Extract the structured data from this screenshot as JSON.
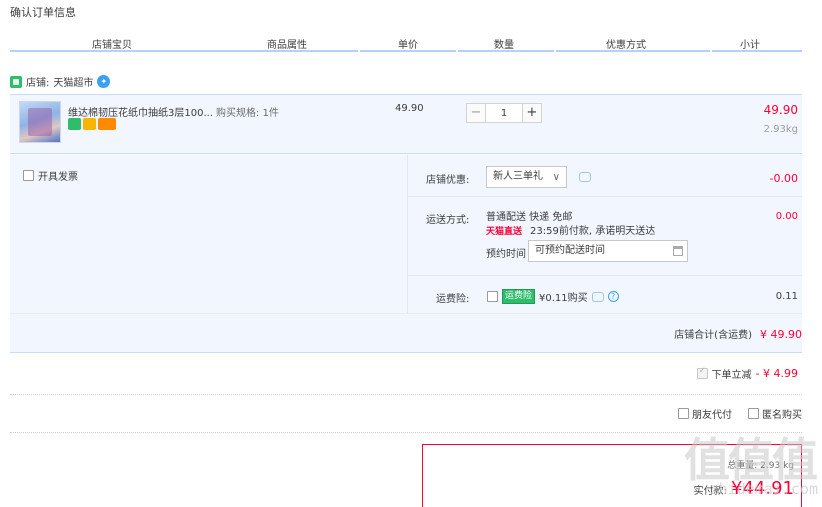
{
  "page_title": "确认订单信息",
  "columns": [
    "店铺宝贝",
    "商品属性",
    "单价",
    "数量",
    "优惠方式",
    "小计"
  ],
  "shop": {
    "label": "店铺:",
    "name": "天猫超市"
  },
  "item": {
    "name": "维达棉韧压花纸巾抽纸3层100...",
    "sku": "购买规格: 1件",
    "price": "49.90",
    "quantity": "1",
    "subtotal": "49.90",
    "weight": "2.93kg",
    "qty_minus": "−",
    "qty_plus": "+"
  },
  "invoice": {
    "label": "开具发票"
  },
  "shop_discount": {
    "label": "店铺优惠:",
    "selected": "新人三单礼",
    "value": "-0.00"
  },
  "shipping": {
    "label": "运送方式:",
    "method": "普通配送 快递 免邮",
    "value": "0.00",
    "tmall_tag": "天猫直送",
    "promise": "23:59前付款, 承诺明天送达",
    "appt_label": "预约时间",
    "appt_placeholder": "可预约配送时间"
  },
  "insurance": {
    "label": "运费险:",
    "badge": "运费险",
    "price": "¥0.11购买",
    "value": "0.11"
  },
  "shop_total": {
    "label": "店铺合计(含运费)",
    "value": "¥ 49.90"
  },
  "instant_reduce": {
    "label": "下单立减",
    "value": "- ¥ 4.99"
  },
  "pay_options": {
    "friend_pay": "朋友代付",
    "anonymous": "匿名购买"
  },
  "final": {
    "weight_label": "总重量: 2.93 kg",
    "pay_label": "实付款:",
    "amount": "¥44.91"
  },
  "watermark": {
    "big": "值值值",
    "small": "zhidemai.com"
  },
  "colors": {
    "accent": "#ff0036",
    "header_rule": "#b2d1ff",
    "panel_bg": "#f2f7ff"
  }
}
